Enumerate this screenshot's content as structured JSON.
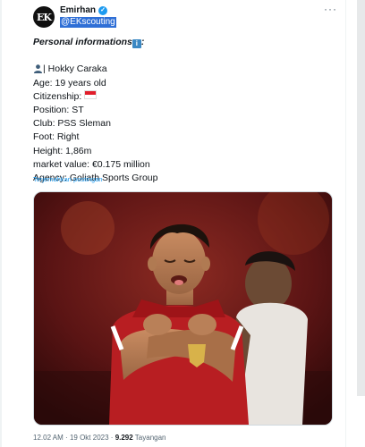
{
  "author": {
    "avatar_text": "EK",
    "name": "Emirhan",
    "handle": "@EKscouting",
    "verified": true
  },
  "post": {
    "title": "Personal informations",
    "title_suffix": ":",
    "lines": [
      "| Hokky Caraka",
      "Age: 19 years old",
      "Citizenship:",
      "Position: ST",
      "Club: PSS Sleman",
      "Foot: Right",
      "Height: 1,86m",
      "market value: €0.175 million",
      "Agency: Goliath Sports Group"
    ],
    "translate_label": "Terjemahkan postingan"
  },
  "meta": {
    "time": "12.02 AM",
    "separator": "·",
    "date": "19 Okt 2023",
    "views": "9.292",
    "views_label": "Tayangan"
  },
  "colors": {
    "accent": "#1d9bf0",
    "jersey_red": "#b81e22",
    "flag_red": "#e11d2a"
  },
  "icons": {
    "verified": "verified-badge-icon",
    "info": "information-icon",
    "user": "bust-silhouette-icon",
    "flag": "indonesia-flag-icon",
    "more": "more-options-icon"
  }
}
